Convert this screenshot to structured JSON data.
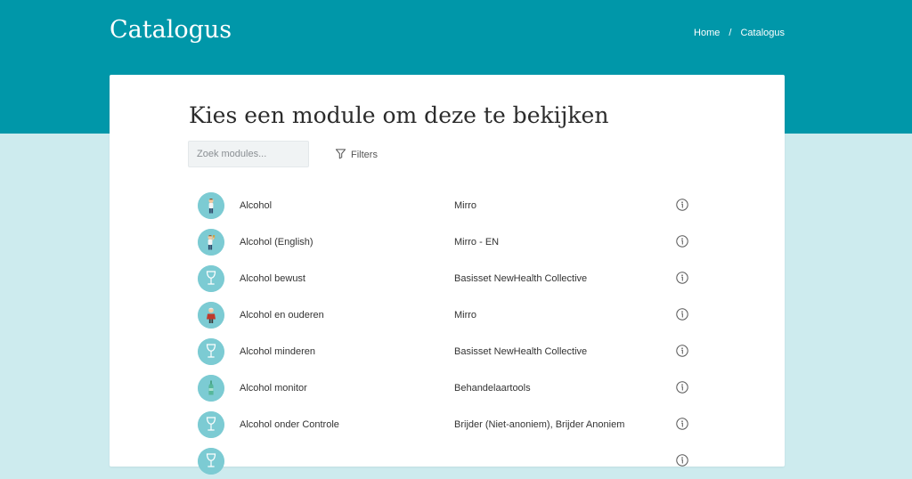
{
  "header": {
    "title": "Catalogus",
    "breadcrumb": {
      "home": "Home",
      "separator": "/",
      "current": "Catalogus"
    }
  },
  "main": {
    "heading": "Kies een module om deze te bekijken",
    "search_placeholder": "Zoek modules...",
    "filters_label": "Filters",
    "modules": [
      {
        "name": "Alcohol",
        "provider": "Mirro",
        "icon": "person-icon"
      },
      {
        "name": "Alcohol (English)",
        "provider": "Mirro - EN",
        "icon": "person-drinking-icon"
      },
      {
        "name": "Alcohol bewust",
        "provider": "Basisset NewHealth Collective",
        "icon": "wine-glass-icon"
      },
      {
        "name": "Alcohol en ouderen",
        "provider": "Mirro",
        "icon": "elderly-person-icon"
      },
      {
        "name": "Alcohol minderen",
        "provider": "Basisset NewHealth Collective",
        "icon": "wine-glass-icon"
      },
      {
        "name": "Alcohol monitor",
        "provider": "Behandelaartools",
        "icon": "bottle-icon"
      },
      {
        "name": "Alcohol onder Controle",
        "provider": "Brijder (Niet-anoniem), Brijder Anoniem",
        "icon": "wine-glass-icon"
      },
      {
        "name": "",
        "provider": "",
        "icon": "wine-glass-icon"
      }
    ]
  },
  "colors": {
    "header_bg": "#0097a9",
    "page_bg": "#cdebee",
    "avatar_bg": "#7ccbd3"
  }
}
